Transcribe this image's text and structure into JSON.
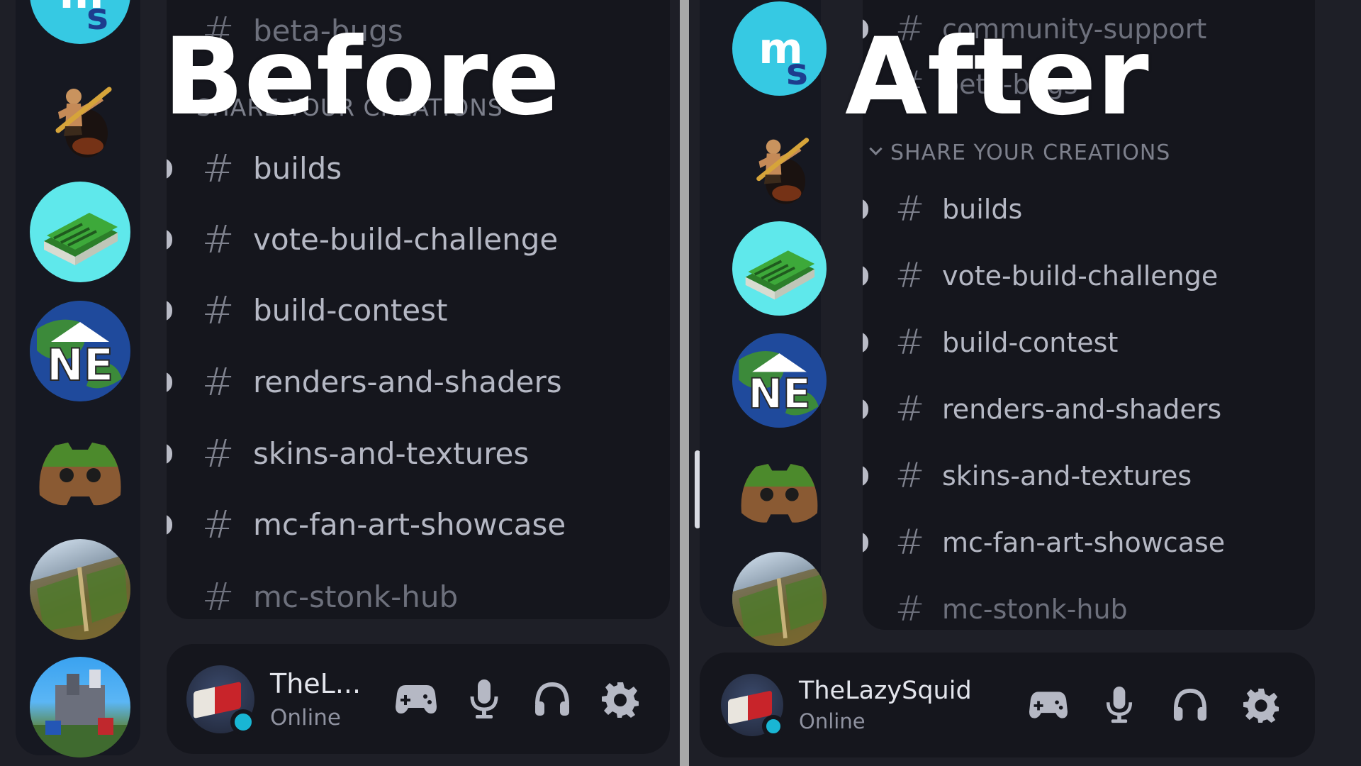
{
  "before": {
    "label": "Before",
    "top_channel": "beta-bugs",
    "category": "SHARE YOUR CREATIONS",
    "channels": [
      "builds",
      "vote-build-challenge",
      "build-contest",
      "renders-and-shaders",
      "skins-and-textures",
      "mc-fan-art-showcase",
      "mc-stonk-hub"
    ],
    "user": {
      "name": "TheL...",
      "status": "Online"
    }
  },
  "after": {
    "label": "After",
    "top_channels": [
      "community-support",
      "beta-bugs"
    ],
    "category": "SHARE YOUR CREATIONS",
    "channels": [
      "builds",
      "vote-build-challenge",
      "build-contest",
      "renders-and-shaders",
      "skins-and-textures",
      "mc-fan-art-showcase",
      "mc-stonk-hub"
    ],
    "user": {
      "name": "TheLazySquid",
      "status": "Online"
    }
  },
  "icons": {
    "hash": "#",
    "controls": [
      "gamepad-icon",
      "microphone-icon",
      "headphones-icon",
      "gear-icon"
    ]
  },
  "colors": {
    "background": "#1e1f27",
    "card": "#15161d",
    "status_online": "#19b6d4",
    "logo_blue": "#36c9e3"
  }
}
